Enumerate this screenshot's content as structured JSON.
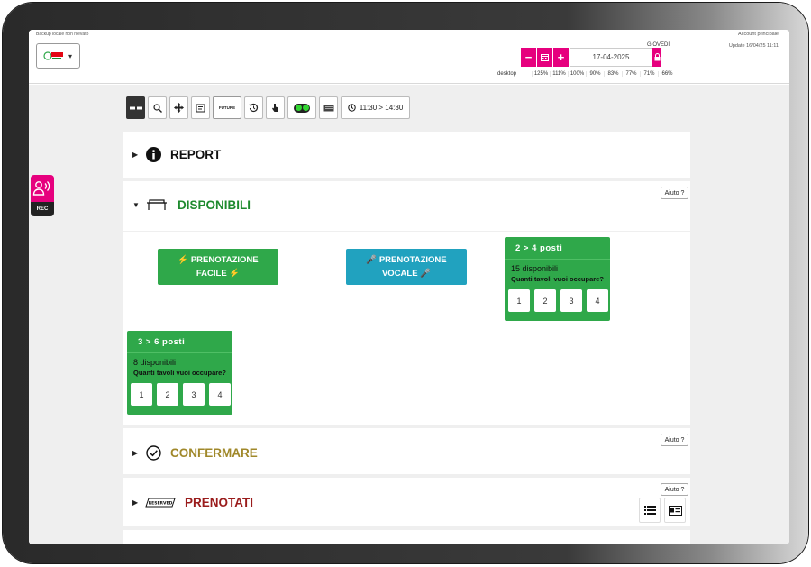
{
  "header": {
    "backup_text": "Backup locale non rilevato",
    "account_label": "Account principale",
    "update_label": "Update 16/04/25 11:11",
    "date_value": "17-04-2025",
    "day_label": "GIOVEDÌ",
    "minus_label": "−",
    "plus_label": "+",
    "zoom_device": "desktop",
    "zoom_levels": [
      "125%",
      "111%",
      "100%",
      "90%",
      "83%",
      "77%",
      "71%",
      "66%"
    ]
  },
  "toolbar": {
    "future_label": "FUTURE",
    "time_range": "11:30 > 14:30"
  },
  "rec": {
    "label": "REC"
  },
  "sections": {
    "report": {
      "title": "REPORT",
      "color": "#111111"
    },
    "disponibili": {
      "title": "DISPONIBILI",
      "color": "#1e8a2e",
      "help": "Aiuto ?"
    },
    "confermare": {
      "title": "CONFERMARE",
      "color": "#a0882a",
      "help": "Aiuto ?"
    },
    "prenotati": {
      "title": "PRENOTATI",
      "color": "#9a1c1c",
      "help": "Aiuto ?",
      "reserved_icon_text": "RESERVED"
    }
  },
  "booking": {
    "easy_line1": "⚡ PRENOTAZIONE",
    "easy_line2": "FACILE ⚡",
    "voice_line1": "🎤 PRENOTAZIONE",
    "voice_line2": "VOCALE 🎤"
  },
  "cards": [
    {
      "title": "2 > 4 posti",
      "available": "15 disponibili",
      "question": "Quanti tavoli vuoi occupare?",
      "options": [
        "1",
        "2",
        "3",
        "4"
      ]
    },
    {
      "title": "3 > 6 posti",
      "available": "8 disponibili",
      "question": "Quanti tavoli vuoi occupare?",
      "options": [
        "1",
        "2",
        "3",
        "4"
      ]
    }
  ],
  "colors": {
    "accent": "#e6007e",
    "green": "#2fa84a",
    "teal": "#21a2bf"
  }
}
